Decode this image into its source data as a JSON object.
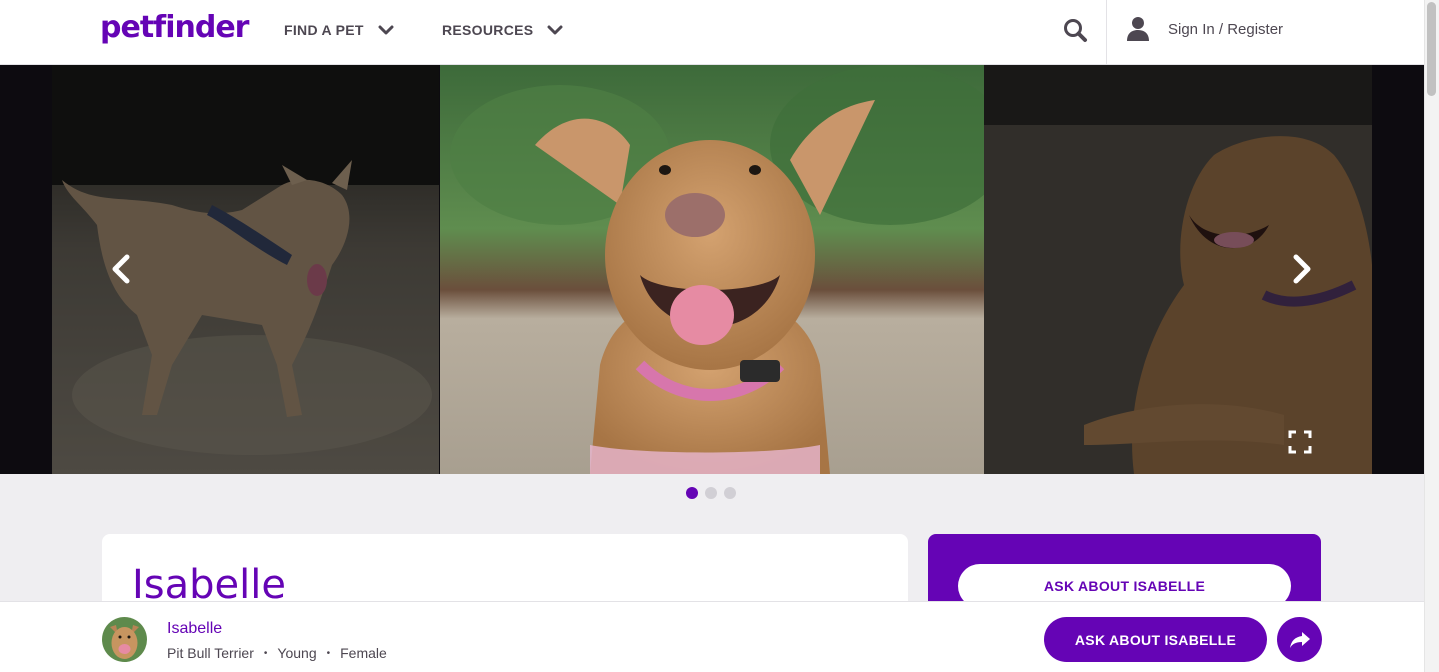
{
  "header": {
    "logo": "petfinder",
    "nav": [
      {
        "label": "FIND A PET"
      },
      {
        "label": "RESOURCES"
      }
    ],
    "account_label": "Sign In / Register"
  },
  "carousel": {
    "photos": [
      "dog-walking-photo",
      "dog-smiling-photo",
      "dog-lying-photo"
    ],
    "active_index": 0,
    "count": 3
  },
  "pet": {
    "name": "Isabelle",
    "breed": "Pit Bull Terrier",
    "age": "Young",
    "gender": "Female",
    "separator": "•"
  },
  "cta": {
    "ask_label": "ASK ABOUT ISABELLE"
  },
  "colors": {
    "brand": "#6504b5",
    "text": "#4d4751",
    "page_bg": "#efeef1"
  }
}
